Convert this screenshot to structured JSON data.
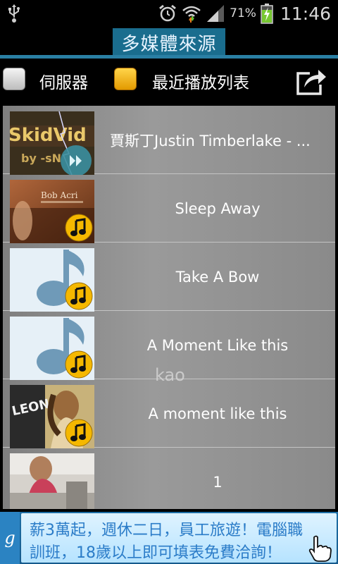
{
  "status_bar": {
    "battery_percent": "71%",
    "time": "11:46",
    "icons": [
      "usb-icon",
      "alarm-icon",
      "wifi-icon",
      "signal-icon",
      "battery-charging-icon"
    ]
  },
  "header": {
    "title": "多媒體來源"
  },
  "tabs": {
    "server_label": "伺服器",
    "recent_label": "最近播放列表",
    "share_icon": "share-icon"
  },
  "list": {
    "items": [
      {
        "title": "賈斯丁Justin Timberlake - ...",
        "badge": "fast-forward-icon",
        "thumb": "skid-video-art"
      },
      {
        "title": "Sleep Away",
        "badge": "music-note-icon",
        "thumb": "bob-acri-album-art"
      },
      {
        "title": "Take A Bow",
        "badge": "music-note-icon",
        "thumb": "music-note-placeholder"
      },
      {
        "title": "A Moment Like this",
        "badge": "music-note-icon",
        "thumb": "music-note-placeholder"
      },
      {
        "title": "A moment like this",
        "badge": "music-note-icon",
        "thumb": "leona-album-art"
      },
      {
        "title": "1",
        "badge": "",
        "thumb": "photo-thumbnail"
      }
    ],
    "thumb_text_1": "SkidVid",
    "thumb_text_1b": "by -sN",
    "thumb_text_2": "Bob Acri",
    "thumb_text_5": "LEONA",
    "watermark": "kao"
  },
  "ad": {
    "logo": "g",
    "line1": "薪3萬起，週休二日，員工旅遊！電腦職",
    "line2": "訓班，18歲以上即可填表免費洽詢！"
  },
  "colors": {
    "title_bg": "#1a6d8e",
    "accent_line": "#2a7fa4",
    "recent_check": "#f5b800",
    "badge_yellow": "#f5b800",
    "ad_bg": "#1e6fa6"
  }
}
